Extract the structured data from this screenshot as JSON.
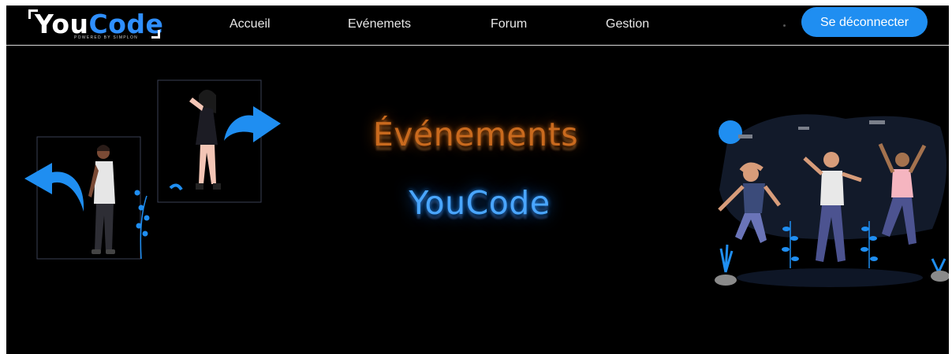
{
  "brand": {
    "logo_prefix": "You",
    "logo_suffix": "Code",
    "logo_tagline": "POWERED BY SIMPLON"
  },
  "nav": {
    "items": [
      {
        "label": "Accueil"
      },
      {
        "label": "Evénemets"
      },
      {
        "label": "Forum"
      },
      {
        "label": "Gestion"
      }
    ],
    "logout_label": "Se déconnecter"
  },
  "hero": {
    "title": "Événements",
    "subtitle": "YouCode"
  },
  "colors": {
    "background": "#000000",
    "accent_blue": "#1f8ef1",
    "title_orange": "#c96a1e",
    "subtitle_blue": "#4aa6ff"
  },
  "icons": {
    "left_illustration": "people-with-arrows-illustration",
    "right_illustration": "jumping-people-illustration"
  }
}
